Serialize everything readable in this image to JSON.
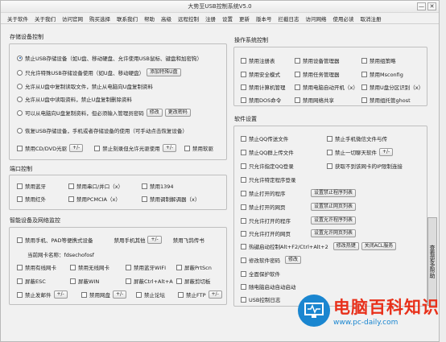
{
  "window": {
    "title": "大势至USB控制系统V5.0",
    "btn_min": "—",
    "btn_close": "✕"
  },
  "menu": [
    "关于软件",
    "关于我们",
    "访问官网",
    "购买选择",
    "联系我们",
    "帮助",
    "高级",
    "远程控制",
    "注册",
    "设置",
    "更新",
    "版本号",
    "拦截日志",
    "访问网络",
    "使用必读",
    "取消注册"
  ],
  "storage": {
    "title": "存储设备控制",
    "radios": [
      "禁止USB存储设备（如U盘、移动硬盘、允许使用USB鼠标、键盘和加密狗）",
      "只允许特殊USB存储设备使用（如U盘、移动硬盘）",
      "允许从U盘中复制读取文件，禁止从电脑向U盘复制资料",
      "允许从U盘中读取资料，禁止U盘复制删除资料",
      "可以从电脑向U盘复制资料，但必须输入管理员密码",
      "恢复USB存储设备，手机或者存储设备的使用（可手动点击恢复设备）"
    ],
    "btn_add": "添加特殊U盘",
    "btn_modify": "修改",
    "btn_change": "更改密码",
    "row_cd": "禁用CD/DVD光驱",
    "row_burn": "禁止刻录但允许光驱使用",
    "row_floppy": "禁用软驱",
    "btn_plus": "+/-"
  },
  "port": {
    "title": "端口控制",
    "items": [
      "禁用蓝牙",
      "禁用串口/并口（x）",
      "禁用1394",
      "禁用红外",
      "禁用PCMCIA（x）",
      "禁用调制解调器（x）"
    ]
  },
  "smart": {
    "title": "智能设备及网络监控",
    "row1a": "禁用手机、PAD等便携式设备",
    "row1b": "禁用手机其他",
    "row1c": "禁用飞鸽传书",
    "netname": "当前网卡名称：fdsechofosf",
    "items": [
      "禁用有线网卡",
      "禁用无线网卡",
      "禁用蓝牙WIFI",
      "屏蔽PrtScn",
      "屏蔽ESC",
      "屏蔽WIN",
      "屏蔽Ctrl+Alt+A",
      "屏蔽剪切板",
      "禁止发邮件",
      "禁用网盘",
      "禁止论坛",
      "禁止FTP"
    ]
  },
  "os": {
    "title": "操作系统控制",
    "items": [
      "禁用注册表",
      "禁用设备管理器",
      "禁用组策略",
      "禁用安全模式",
      "禁用任务管理器",
      "禁用Msconfig",
      "禁用计算机管理",
      "禁用电脑自动开机（x）",
      "禁用U盘分区识别（x）",
      "禁用DOS命令",
      "禁用网络共享",
      "禁用组托管ghost"
    ]
  },
  "software": {
    "title": "软件设置",
    "chat": [
      "禁止QQ传送文件",
      "禁止手机微信文件与传",
      "禁止QQ群上传文件",
      "禁止一切聊天软件",
      "只允许指定QQ登录",
      "获取不到该网卡的IP限制连接"
    ],
    "items": [
      {
        "label": "只允许特定程序登录"
      },
      {
        "label": "禁止打开的程序",
        "btn": "设置禁止程序列表"
      },
      {
        "label": "禁止打开的网页",
        "btn": "设置禁止网页列表"
      },
      {
        "label": "只允许打开的程序",
        "btn": "设置允许程序列表"
      },
      {
        "label": "只允许打开的网页",
        "btn": "设置允许网页列表"
      },
      {
        "label": "热键启动控制Alt+F2/Ctrl+Alt+2",
        "btn": "修改热键",
        "btn2": "关闭ACL服务"
      },
      {
        "label": "修改软件密码",
        "btn": "修改"
      },
      {
        "label": "全面保护软件"
      },
      {
        "label": "随电脑启动自动启动"
      },
      {
        "label": "USB控制日志"
      }
    ]
  },
  "sidetab": "查看更多帮助",
  "watermark": {
    "title": "电脑百科知识",
    "url": "www.pc-daily.com"
  }
}
